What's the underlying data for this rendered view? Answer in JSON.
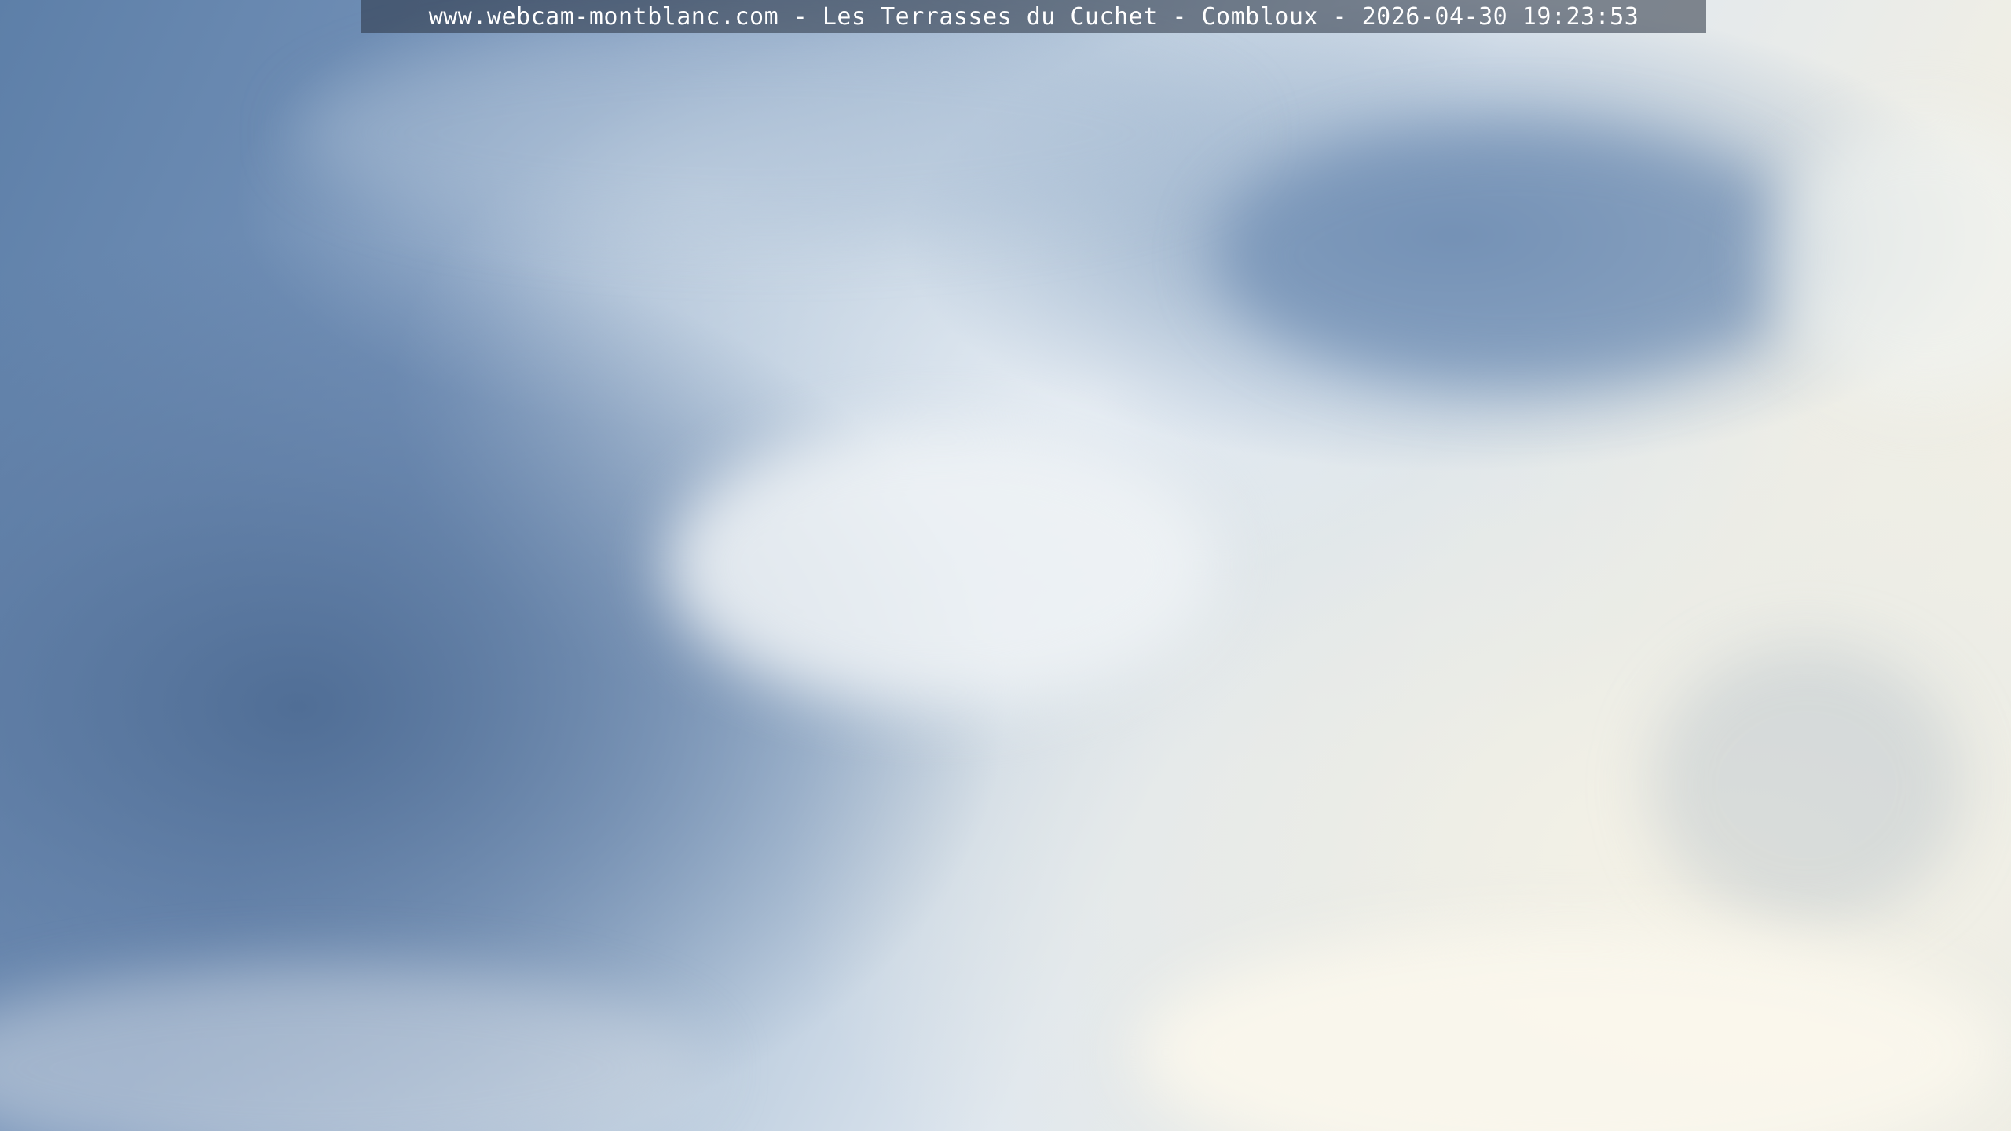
{
  "webcam": {
    "caption": "www.webcam-montblanc.com - Les Terrasses du Cuchet - Combloux - 2026-04-30 19:23:53"
  },
  "scene": {
    "subject": "cloudy sky",
    "colors": {
      "sky_blue": "#5d7fa8",
      "cloud_white": "#f6f2e3",
      "caption_bar": "#28323f"
    }
  }
}
